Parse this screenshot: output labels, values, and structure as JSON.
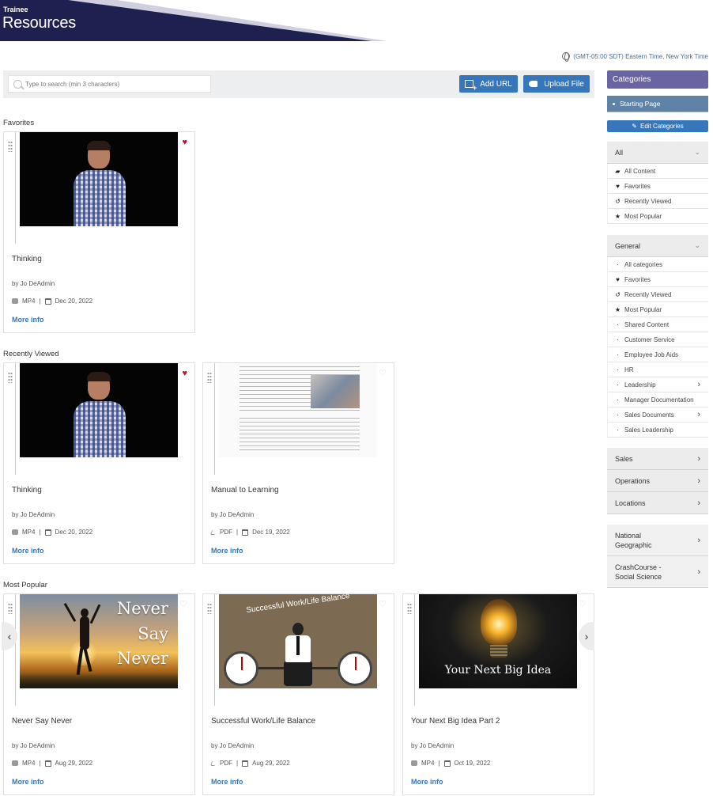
{
  "header": {
    "subtitle": "Trainee",
    "title": "Resources"
  },
  "timezone": "(GMT-05:00 SDT) Eastern Time, New York Time",
  "toolbar": {
    "search_placeholder": "Type to search (min 3 characters)",
    "add_url_label": "Add URL",
    "upload_label": "Upload File"
  },
  "sections": {
    "favorites": "Favorites",
    "recent": "Recently Viewed",
    "popular": "Most Popular"
  },
  "more_info": "More info",
  "cards": {
    "fav_thinking": {
      "title": "Thinking",
      "author": "by Jo DeAdmin",
      "type": "MP4",
      "date": "Dec 20, 2022",
      "favorited": true
    },
    "recent_thinking": {
      "title": "Thinking",
      "author": "by Jo DeAdmin",
      "type": "MP4",
      "date": "Dec 20, 2022",
      "favorited": true
    },
    "recent_manual": {
      "title": "Manual to Learning",
      "author": "by Jo DeAdmin",
      "type": "PDF",
      "date": "Dec 19, 2022",
      "favorited": false
    },
    "pop_never": {
      "title": "Never Say Never",
      "author": "by Jo DeAdmin",
      "type": "MP4",
      "date": "Aug 29, 2022",
      "favorited": false,
      "thumb_words": [
        "Never",
        "Say",
        "Never"
      ]
    },
    "pop_wlb": {
      "title": "Successful Work/Life Balance",
      "author": "by Jo DeAdmin",
      "type": "PDF",
      "date": "Aug 29, 2022",
      "favorited": false,
      "thumb_caption": "Successful Work/Life Balance"
    },
    "pop_idea": {
      "title": "Your Next Big Idea Part 2",
      "author": "by Jo DeAdmin",
      "type": "MP4",
      "date": "Oct 19, 2022",
      "favorited": false,
      "thumb_caption": "Your Next Big Idea"
    }
  },
  "sidebar": {
    "categories_label": "Categories",
    "starting_page": "Starting Page",
    "edit_categories": "Edit Categories",
    "all_group": {
      "label": "All",
      "items": [
        "All Content",
        "Favorites",
        "Recently Viewed",
        "Most Popular"
      ]
    },
    "general_group": {
      "label": "General",
      "items": [
        "All categories",
        "Favorites",
        "Recently Viewed",
        "Most Popular",
        "Shared Content",
        "Customer Service",
        "Employee Job Aids",
        "HR",
        "Leadership",
        "Manager Documentation",
        "Sales Documents",
        "Sales Leadership"
      ]
    },
    "groups": [
      "Sales",
      "Operations",
      "Locations"
    ],
    "extra_groups": [
      "National Geographic",
      "CrashCourse - Social Science"
    ]
  },
  "colors": {
    "accent": "#3676bb",
    "header_dark": "#1e2050",
    "categories": "#6b64a3",
    "heart": "#c40f2c"
  }
}
